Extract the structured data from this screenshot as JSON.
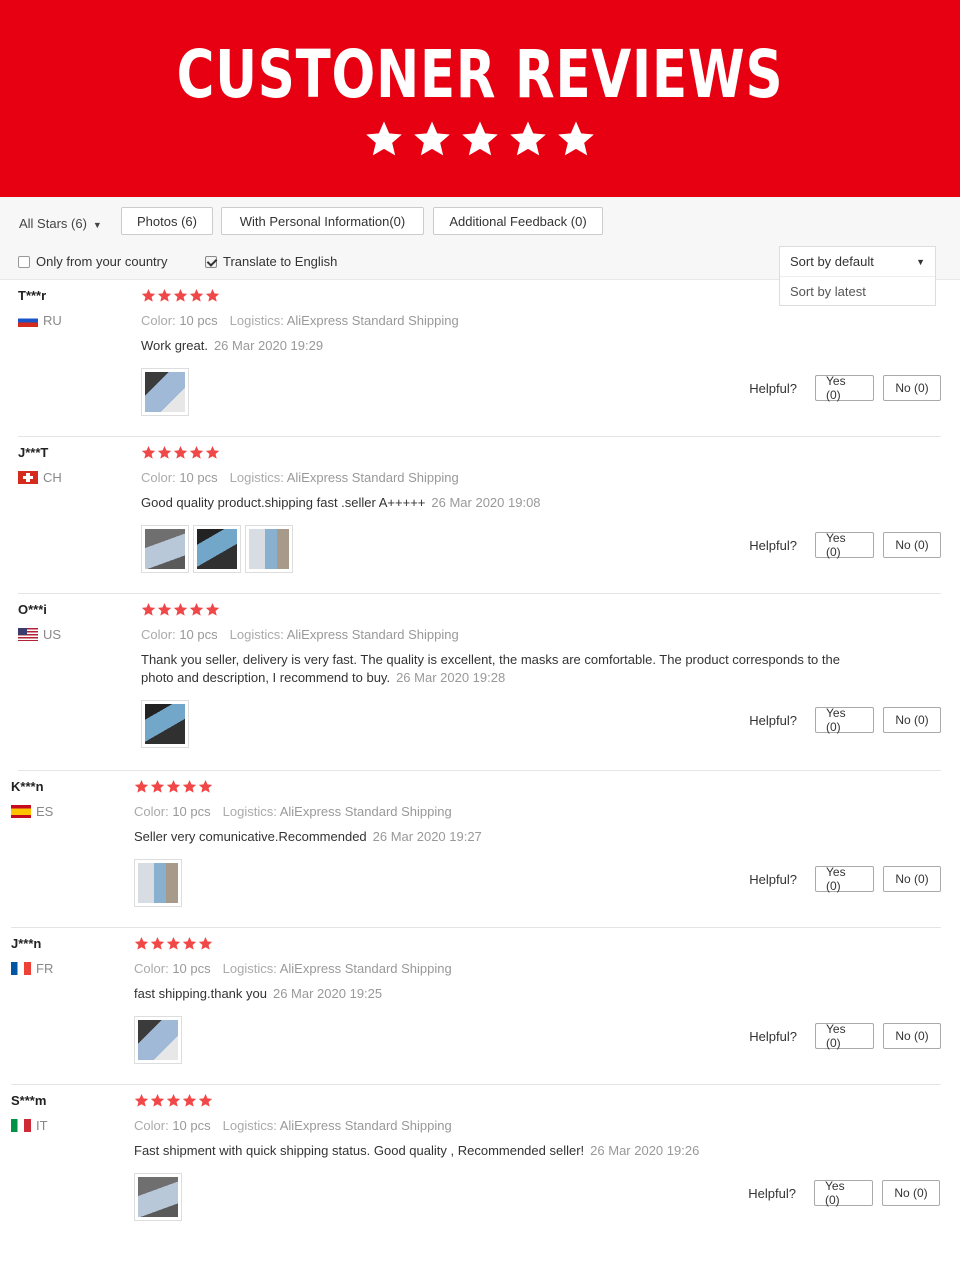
{
  "banner": {
    "title": "CUSTONER REVIEWS",
    "stars": 5
  },
  "filters": {
    "all_stars": "All Stars (6)",
    "photos": "Photos (6)",
    "personal": "With Personal Information(0)",
    "feedback": "Additional Feedback (0)",
    "only_country": "Only from your country",
    "translate": "Translate to English",
    "translate_checked": true,
    "only_country_checked": false
  },
  "sort": {
    "selected": "Sort by default",
    "option": "Sort by latest"
  },
  "labels": {
    "color": "Color:",
    "logistics": "Logistics:",
    "helpful": "Helpful?",
    "yes": "Yes (0)",
    "no": "No (0)"
  },
  "colors": {
    "brand": "#e60012",
    "star": "#f04848"
  },
  "reviews": [
    {
      "user": "T***r",
      "country": "RU",
      "rating": 5,
      "color": "10 pcs",
      "logistics": "AliExpress Standard Shipping",
      "text": "Work great.",
      "date": "26 Mar 2020 19:29",
      "photos": 1
    },
    {
      "user": "J***T",
      "country": "CH",
      "rating": 5,
      "color": "10 pcs",
      "logistics": "AliExpress Standard Shipping",
      "text": "Good quality product.shipping fast .seller A+++++",
      "date": "26 Mar 2020 19:08",
      "photos": 3
    },
    {
      "user": "O***i",
      "country": "US",
      "rating": 5,
      "color": "10 pcs",
      "logistics": "AliExpress Standard Shipping",
      "text": "Thank you seller, delivery is very fast. The quality is excellent, the masks are comfortable. The product corresponds to the photo and description, I recommend to buy.",
      "date": "26 Mar 2020 19:28",
      "photos": 1
    },
    {
      "user": "K***n",
      "country": "ES",
      "rating": 5,
      "color": "10 pcs",
      "logistics": "AliExpress Standard Shipping",
      "text": "Seller very comunicative.Recommended",
      "date": "26 Mar 2020 19:27",
      "photos": 1
    },
    {
      "user": "J***n",
      "country": "FR",
      "rating": 5,
      "color": "10 pcs",
      "logistics": "AliExpress Standard Shipping",
      "text": "fast shipping.thank you",
      "date": "26 Mar 2020 19:25",
      "photos": 1
    },
    {
      "user": "S***m",
      "country": "IT",
      "rating": 5,
      "color": "10 pcs",
      "logistics": "AliExpress Standard Shipping",
      "text": "Fast shipment with quick shipping status. Good quality , Recommended seller!",
      "date": "26 Mar 2020 19:26",
      "photos": 1
    }
  ]
}
